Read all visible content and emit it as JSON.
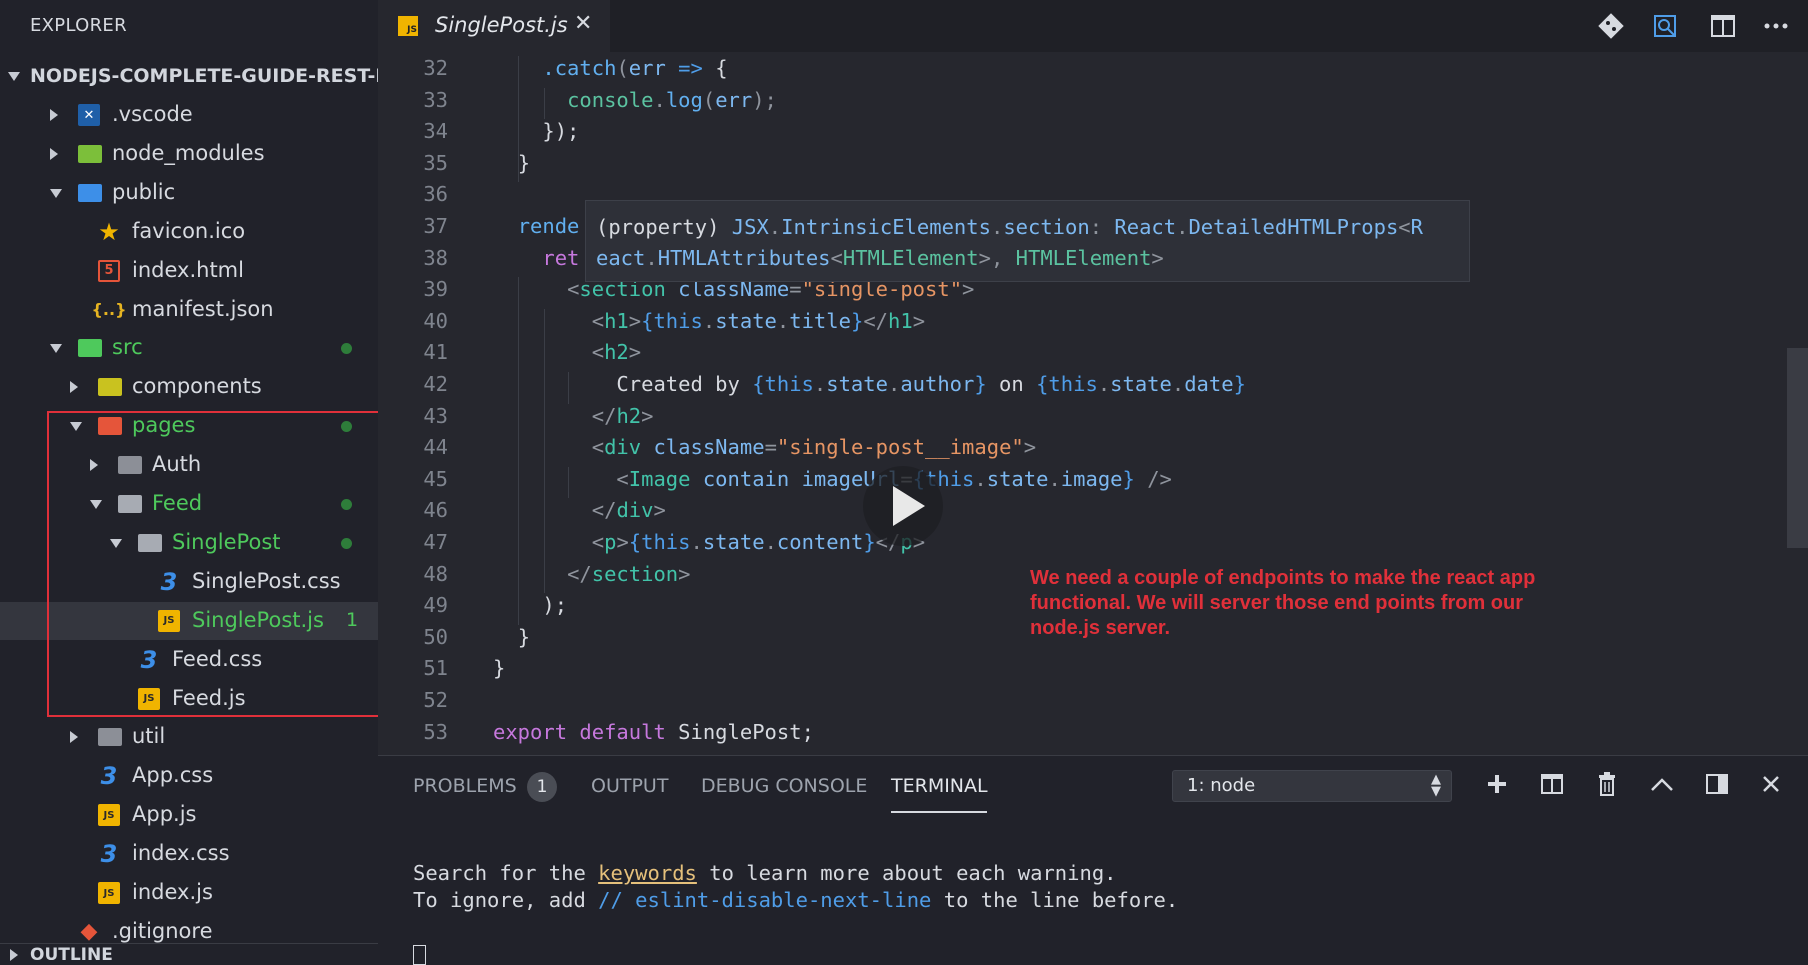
{
  "sidebar": {
    "title": "EXPLORER",
    "project_name": "NODEJS-COMPLETE-GUIDE-REST-F...",
    "items": [
      {
        "label": ".vscode",
        "icon": "vscode-folder-icon",
        "twisty": "closed",
        "green": false
      },
      {
        "label": "node_modules",
        "icon": "node-folder-icon",
        "twisty": "closed",
        "green": false
      },
      {
        "label": "public",
        "icon": "public-folder-icon",
        "twisty": "open",
        "green": false
      },
      {
        "label": "favicon.ico",
        "icon": "star-icon",
        "twisty": "",
        "green": false
      },
      {
        "label": "index.html",
        "icon": "html-file-icon",
        "twisty": "",
        "green": false
      },
      {
        "label": "manifest.json",
        "icon": "json-file-icon",
        "twisty": "",
        "green": false
      },
      {
        "label": "src",
        "icon": "src-folder-icon",
        "twisty": "open",
        "green": true
      },
      {
        "label": "components",
        "icon": "components-folder-icon",
        "twisty": "closed",
        "green": false
      },
      {
        "label": "pages",
        "icon": "pages-folder-icon",
        "twisty": "open",
        "green": true
      },
      {
        "label": "Auth",
        "icon": "folder-icon",
        "twisty": "closed",
        "green": false
      },
      {
        "label": "Feed",
        "icon": "folder-open-icon",
        "twisty": "open",
        "green": true
      },
      {
        "label": "SinglePost",
        "icon": "folder-open-icon",
        "twisty": "open",
        "green": true
      },
      {
        "label": "SinglePost.css",
        "icon": "css-file-icon",
        "twisty": "",
        "green": false
      },
      {
        "label": "SinglePost.js",
        "icon": "js-file-icon",
        "twisty": "",
        "green": true,
        "count": "1"
      },
      {
        "label": "Feed.css",
        "icon": "css-file-icon",
        "twisty": "",
        "green": false
      },
      {
        "label": "Feed.js",
        "icon": "js-file-icon",
        "twisty": "",
        "green": false
      },
      {
        "label": "util",
        "icon": "folder-icon",
        "twisty": "closed",
        "green": false
      },
      {
        "label": "App.css",
        "icon": "css-file-icon",
        "twisty": "",
        "green": false
      },
      {
        "label": "App.js",
        "icon": "js-file-icon",
        "twisty": "",
        "green": false
      },
      {
        "label": "index.css",
        "icon": "css-file-icon",
        "twisty": "",
        "green": false
      },
      {
        "label": "index.js",
        "icon": "js-file-icon",
        "twisty": "",
        "green": false
      },
      {
        "label": ".gitignore",
        "icon": "git-file-icon",
        "twisty": "",
        "green": false
      }
    ],
    "outline_label": "OUTLINE"
  },
  "editor": {
    "tab_label": "SinglePost.js",
    "tab_icon_text": "JS",
    "toolbar_icons": [
      "git-compare-icon",
      "search-files-icon",
      "split-editor-icon",
      "more-actions-icon"
    ],
    "lines": [
      {
        "n": "32",
        "html": "    <span class='c-fn'>.catch</span><span class='c-punc'>(</span><span class='c-var'>err</span> <span class='c-kw2'>=&gt;</span> <span class='c-plain'>{</span>"
      },
      {
        "n": "33",
        "html": "      <span class='c-green'>console</span><span class='c-punc'>.</span><span class='c-fn'>log</span><span class='c-punc'>(</span><span class='c-var'>err</span><span class='c-punc'>);</span>"
      },
      {
        "n": "34",
        "html": "    <span class='c-plain'>});</span>"
      },
      {
        "n": "35",
        "html": "  <span class='c-plain'>}</span>"
      },
      {
        "n": "36",
        "html": ""
      },
      {
        "n": "37",
        "html": "  <span class='c-fn'>rende</span>"
      },
      {
        "n": "38",
        "html": "    <span class='c-kw'>ret</span>"
      },
      {
        "n": "39",
        "html": "      <span class='c-punc'>&lt;</span><span class='c-tag'>section</span> <span class='c-var'>className</span><span class='c-punc'>=</span><span class='c-str'>\"single-post\"</span><span class='c-punc'>&gt;</span>"
      },
      {
        "n": "40",
        "html": "        <span class='c-punc'>&lt;</span><span class='c-tag'>h1</span><span class='c-punc'>&gt;</span><span class='c-kw2'>{this</span><span class='c-punc'>.</span><span class='c-var'>state</span><span class='c-punc'>.</span><span class='c-var'>title</span><span class='c-kw2'>}</span><span class='c-punc'>&lt;/</span><span class='c-tag'>h1</span><span class='c-punc'>&gt;</span>"
      },
      {
        "n": "41",
        "html": "        <span class='c-punc'>&lt;</span><span class='c-tag'>h2</span><span class='c-punc'>&gt;</span>"
      },
      {
        "n": "42",
        "html": "          <span class='c-plain'>Created by </span><span class='c-kw2'>{this</span><span class='c-punc'>.</span><span class='c-var'>state</span><span class='c-punc'>.</span><span class='c-var'>author</span><span class='c-kw2'>}</span><span class='c-plain'> on </span><span class='c-kw2'>{this</span><span class='c-punc'>.</span><span class='c-var'>state</span><span class='c-punc'>.</span><span class='c-var'>date</span><span class='c-kw2'>}</span>"
      },
      {
        "n": "43",
        "html": "        <span class='c-punc'>&lt;/</span><span class='c-tag'>h2</span><span class='c-punc'>&gt;</span>"
      },
      {
        "n": "44",
        "html": "        <span class='c-punc'>&lt;</span><span class='c-tag'>div</span> <span class='c-var'>className</span><span class='c-punc'>=</span><span class='c-str'>\"single-post__image\"</span><span class='c-punc'>&gt;</span>"
      },
      {
        "n": "45",
        "html": "          <span class='c-punc'>&lt;</span><span class='c-tag'>Image</span> <span class='c-var'>contain</span> <span class='c-var'>imageUrl</span><span class='c-punc'>=</span><span class='c-kw2'>{this</span><span class='c-punc'>.</span><span class='c-var'>state</span><span class='c-punc'>.</span><span class='c-var'>image</span><span class='c-kw2'>}</span> <span class='c-punc'>/&gt;</span>"
      },
      {
        "n": "46",
        "html": "        <span class='c-punc'>&lt;/</span><span class='c-tag'>div</span><span class='c-punc'>&gt;</span>"
      },
      {
        "n": "47",
        "html": "        <span class='c-punc'>&lt;</span><span class='c-tag'>p</span><span class='c-punc'>&gt;</span><span class='c-kw2'>{this</span><span class='c-punc'>.</span><span class='c-var'>state</span><span class='c-punc'>.</span><span class='c-var'>content</span><span class='c-kw2'>}</span><span class='c-punc'>&lt;/</span><span class='c-tag'>p</span><span class='c-punc'>&gt;</span>"
      },
      {
        "n": "48",
        "html": "      <span class='c-punc'>&lt;/</span><span class='c-tag'>section</span><span class='c-punc'>&gt;</span>"
      },
      {
        "n": "49",
        "html": "    <span class='c-plain'>);</span>"
      },
      {
        "n": "50",
        "html": "  <span class='c-plain'>}</span>"
      },
      {
        "n": "51",
        "html": "<span class='c-plain'>}</span>"
      },
      {
        "n": "52",
        "html": ""
      },
      {
        "n": "53",
        "html": "<span class='c-kw'>export</span> <span class='c-kw'>default</span> <span class='c-plain'>SinglePost;</span>"
      }
    ],
    "hover_html": "<span class='c-plain'>(property)</span> <span class='c-var'>JSX</span><span class='c-punc'>.</span><span class='c-var'>IntrinsicElements</span><span class='c-punc'>.</span><span class='c-var'>section</span><span class='c-punc'>:</span> <span class='c-var'>React</span><span class='c-punc'>.</span><span class='c-var'>DetailedHTMLProps</span><span class='c-punc'>&lt;</span><span class='c-var'>R</span>\n<span class='c-var'>eact</span><span class='c-punc'>.</span><span class='c-var'>HTMLAttributes</span><span class='c-punc'>&lt;</span><span class='c-green'>HTMLElement</span><span class='c-punc'>&gt;,</span> <span class='c-green'>HTMLElement</span><span class='c-punc'>&gt;</span>",
    "annotation": "We need a couple of endpoints to make the react app functional. We will server those end points from our node.js server."
  },
  "panel": {
    "tabs": [
      "PROBLEMS",
      "OUTPUT",
      "DEBUG CONSOLE",
      "TERMINAL"
    ],
    "active_tab": "TERMINAL",
    "problems_count": "1",
    "terminal_select": "1: node",
    "buttons": [
      "add-terminal-icon",
      "split-terminal-icon",
      "trash-icon",
      "maximize-panel-icon",
      "toggle-panel-position-icon",
      "close-panel-icon"
    ],
    "terminal_lines": [
      {
        "pre": "Search for the ",
        "mark": "keywords",
        "post": " to learn more about each warning."
      },
      {
        "pre": "To ignore, add ",
        "mark": "// eslint-disable-next-line",
        "post": " to the line before."
      }
    ]
  },
  "colors": {
    "background": "#26272e",
    "sidebar": "#21222a",
    "accent_green": "#4ec95c",
    "annotation_red": "#e0303a"
  }
}
